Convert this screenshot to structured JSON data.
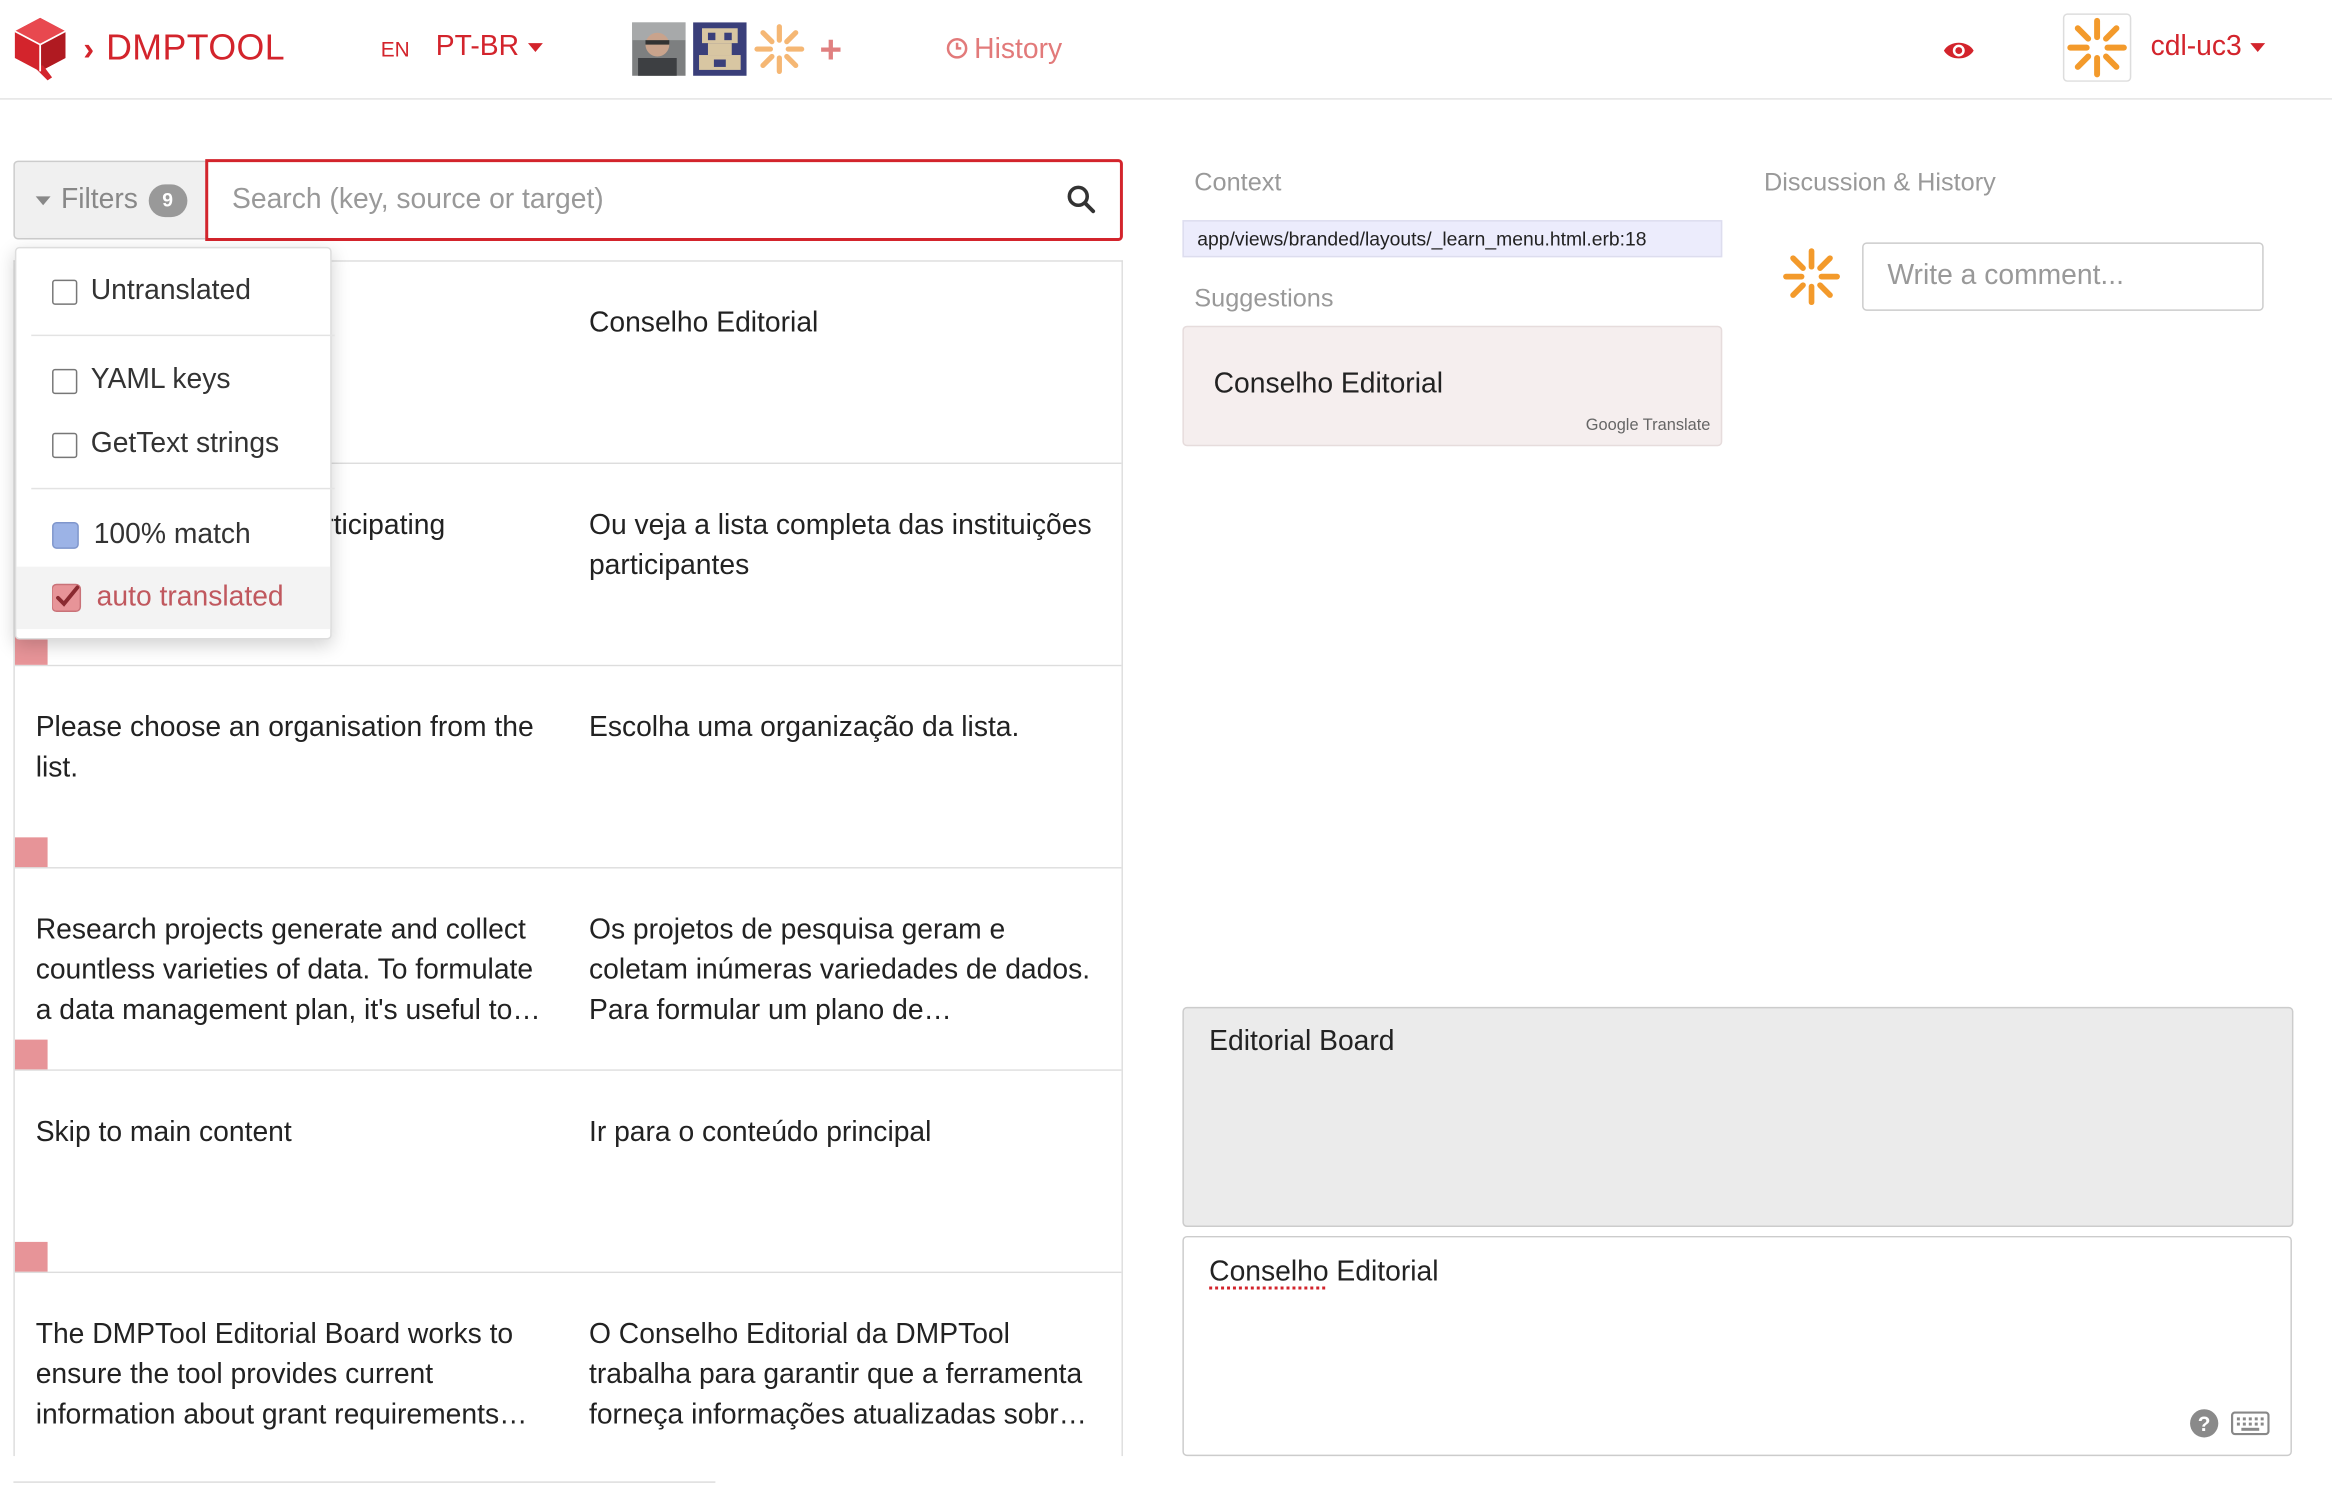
{
  "header": {
    "brand": "DMPTOOL",
    "source_lang": "EN",
    "target_lang": "PT-BR",
    "history_label": "History",
    "username": "cdl-uc3"
  },
  "filters": {
    "label": "Filters",
    "count": "9",
    "options": [
      {
        "label": "Untranslated",
        "checked": false
      },
      {
        "label": "YAML keys",
        "checked": false
      },
      {
        "label": "GetText strings",
        "checked": false
      },
      {
        "label": "100% match",
        "swatch": "#9cb3e6"
      },
      {
        "label": "auto translated",
        "checked": true,
        "swatch": "#e79498"
      }
    ]
  },
  "search": {
    "placeholder": "Search (key, source or target)"
  },
  "rows": [
    {
      "source": "",
      "target": "Conselho Editorial"
    },
    {
      "source": "rticipating",
      "target": "Ou veja a lista completa das instituições participantes"
    },
    {
      "source": "Please choose an organisation from the list.",
      "target": "Escolha uma organização da lista."
    },
    {
      "source": "Research projects generate and collect countless varieties of data. To formulate a data management plan, it's useful to…",
      "target": "Os projetos de pesquisa geram e coletam inúmeras variedades de dados. Para formular um plano de…"
    },
    {
      "source": "Skip to main content",
      "target": "Ir para o conteúdo principal"
    },
    {
      "source": "The DMPTool Editorial Board works to ensure the tool provides current information about grant requirements…",
      "target": "O Conselho Editorial da DMPTool trabalha para garantir que a ferramenta forneça informações atualizadas sobr…"
    }
  ],
  "context": {
    "label": "Context",
    "path": "app/views/branded/layouts/_learn_menu.html.erb:18"
  },
  "suggestions": {
    "label": "Suggestions",
    "text": "Conselho Editorial",
    "provider": "Google Translate"
  },
  "discussion": {
    "label": "Discussion & History",
    "placeholder": "Write a comment..."
  },
  "editor": {
    "source_text": "Editorial Board",
    "target_word1": "Conselho",
    "target_word2": " Editorial"
  },
  "colors": {
    "brand": "#d3242c",
    "auto_translated": "#e79498",
    "full_match": "#9cb3e6",
    "avatar_orange": "#f39a2b"
  }
}
